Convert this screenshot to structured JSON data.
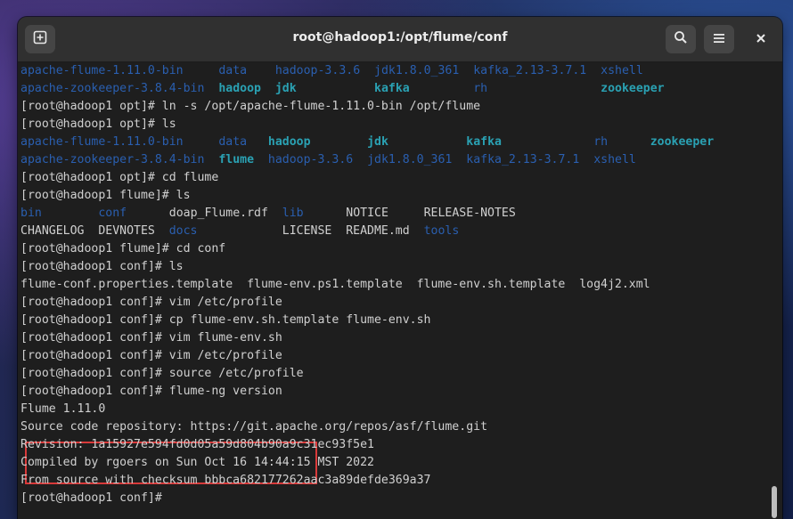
{
  "window": {
    "title": "root@hadoop1:/opt/flume/conf"
  },
  "icons": {
    "new_tab": "new-tab-icon",
    "search": "search-icon",
    "menu": "hamburger-menu-icon",
    "close": "close-icon"
  },
  "colors": {
    "directory": "#2a5fb0",
    "bold_directory": "#3a7fd5",
    "symlink": "#2aa1b3",
    "text": "#d0d0d0",
    "highlight": "#d93a3a"
  },
  "terminal": {
    "lines": [
      {
        "segs": [
          {
            "t": "apache-flume-1.11.0-bin",
            "c": "blue"
          },
          {
            "t": "     "
          },
          {
            "t": "data",
            "c": "blue"
          },
          {
            "t": "    "
          },
          {
            "t": "hadoop-3.3.6",
            "c": "blue"
          },
          {
            "t": "  "
          },
          {
            "t": "jdk1.8.0_361",
            "c": "blue"
          },
          {
            "t": "  "
          },
          {
            "t": "kafka_2.13-3.7.1",
            "c": "blue"
          },
          {
            "t": "  "
          },
          {
            "t": "xshell",
            "c": "blue"
          }
        ]
      },
      {
        "segs": [
          {
            "t": "apache-zookeeper-3.8.4-bin",
            "c": "blue"
          },
          {
            "t": "  "
          },
          {
            "t": "hadoop",
            "c": "cyan"
          },
          {
            "t": "  "
          },
          {
            "t": "jdk",
            "c": "cyan"
          },
          {
            "t": "           "
          },
          {
            "t": "kafka",
            "c": "cyan"
          },
          {
            "t": "         "
          },
          {
            "t": "rh",
            "c": "blue"
          },
          {
            "t": "                "
          },
          {
            "t": "zookeeper",
            "c": "cyan"
          }
        ]
      },
      {
        "segs": [
          {
            "t": "[root@hadoop1 opt]# ln -s /opt/apache-flume-1.11.0-bin /opt/flume"
          }
        ]
      },
      {
        "segs": [
          {
            "t": "[root@hadoop1 opt]# ls"
          }
        ]
      },
      {
        "segs": [
          {
            "t": "apache-flume-1.11.0-bin",
            "c": "blue"
          },
          {
            "t": "     "
          },
          {
            "t": "data",
            "c": "blue"
          },
          {
            "t": "   "
          },
          {
            "t": "hadoop",
            "c": "cyan"
          },
          {
            "t": "        "
          },
          {
            "t": "jdk",
            "c": "cyan"
          },
          {
            "t": "           "
          },
          {
            "t": "kafka",
            "c": "cyan"
          },
          {
            "t": "             "
          },
          {
            "t": "rh",
            "c": "blue"
          },
          {
            "t": "      "
          },
          {
            "t": "zookeeper",
            "c": "cyan"
          }
        ]
      },
      {
        "segs": [
          {
            "t": "apache-zookeeper-3.8.4-bin",
            "c": "blue"
          },
          {
            "t": "  "
          },
          {
            "t": "flume",
            "c": "cyan"
          },
          {
            "t": "  "
          },
          {
            "t": "hadoop-3.3.6",
            "c": "blue"
          },
          {
            "t": "  "
          },
          {
            "t": "jdk1.8.0_361",
            "c": "blue"
          },
          {
            "t": "  "
          },
          {
            "t": "kafka_2.13-3.7.1",
            "c": "blue"
          },
          {
            "t": "  "
          },
          {
            "t": "xshell",
            "c": "blue"
          }
        ]
      },
      {
        "segs": [
          {
            "t": "[root@hadoop1 opt]# cd flume"
          }
        ]
      },
      {
        "segs": [
          {
            "t": "[root@hadoop1 flume]# ls"
          }
        ]
      },
      {
        "segs": [
          {
            "t": "bin",
            "c": "blue"
          },
          {
            "t": "        "
          },
          {
            "t": "conf",
            "c": "blue"
          },
          {
            "t": "      doap_Flume.rdf  "
          },
          {
            "t": "lib",
            "c": "blue"
          },
          {
            "t": "      NOTICE     RELEASE-NOTES"
          }
        ]
      },
      {
        "segs": [
          {
            "t": "CHANGELOG  DEVNOTES  "
          },
          {
            "t": "docs",
            "c": "blue"
          },
          {
            "t": "            LICENSE  README.md  "
          },
          {
            "t": "tools",
            "c": "blue"
          }
        ]
      },
      {
        "segs": [
          {
            "t": "[root@hadoop1 flume]# cd conf"
          }
        ]
      },
      {
        "segs": [
          {
            "t": "[root@hadoop1 conf]# ls"
          }
        ]
      },
      {
        "segs": [
          {
            "t": "flume-conf.properties.template  flume-env.ps1.template  flume-env.sh.template  log4j2.xml"
          }
        ]
      },
      {
        "segs": [
          {
            "t": "[root@hadoop1 conf]# vim /etc/profile"
          }
        ]
      },
      {
        "segs": [
          {
            "t": "[root@hadoop1 conf]# cp flume-env.sh.template flume-env.sh"
          }
        ]
      },
      {
        "segs": [
          {
            "t": "[root@hadoop1 conf]# vim flume-env.sh"
          }
        ]
      },
      {
        "segs": [
          {
            "t": "[root@hadoop1 conf]# vim /etc/profile"
          }
        ]
      },
      {
        "segs": [
          {
            "t": "[root@hadoop1 conf]# source /etc/profile"
          }
        ]
      },
      {
        "segs": [
          {
            "t": "[root@hadoop1 conf]# flume-ng version"
          }
        ]
      },
      {
        "segs": [
          {
            "t": "Flume 1.11.0"
          }
        ]
      },
      {
        "segs": [
          {
            "t": "Source code repository: https://git.apache.org/repos/asf/flume.git"
          }
        ]
      },
      {
        "segs": [
          {
            "t": "Revision: 1a15927e594fd0d05a59d804b90a9c31ec93f5e1"
          }
        ]
      },
      {
        "segs": [
          {
            "t": "Compiled by rgoers on Sun Oct 16 14:44:15 MST 2022"
          }
        ]
      },
      {
        "segs": [
          {
            "t": "From source with checksum bbbca682177262aac3a89defde369a37"
          }
        ]
      },
      {
        "segs": [
          {
            "t": "[root@hadoop1 conf]# "
          }
        ]
      }
    ]
  }
}
